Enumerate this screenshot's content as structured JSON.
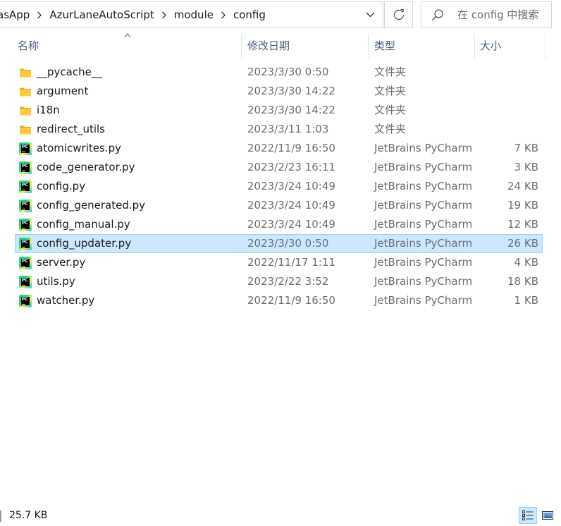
{
  "address_bar": {
    "breadcrumbs": [
      "asApp",
      "AzurLaneAutoScript",
      "module",
      "config"
    ]
  },
  "search": {
    "placeholder": "在 config 中搜索"
  },
  "columns": {
    "name": "名称",
    "date": "修改日期",
    "type": "类型",
    "size": "大小"
  },
  "files": [
    {
      "name": "__pycache__",
      "date": "2023/3/30 0:50",
      "type": "文件夹",
      "size": "",
      "icon": "folder-icon",
      "selected": false
    },
    {
      "name": "argument",
      "date": "2023/3/30 14:22",
      "type": "文件夹",
      "size": "",
      "icon": "folder-icon",
      "selected": false
    },
    {
      "name": "i18n",
      "date": "2023/3/30 14:22",
      "type": "文件夹",
      "size": "",
      "icon": "folder-icon",
      "selected": false
    },
    {
      "name": "redirect_utils",
      "date": "2023/3/11 1:03",
      "type": "文件夹",
      "size": "",
      "icon": "folder-icon",
      "selected": false
    },
    {
      "name": "atomicwrites.py",
      "date": "2022/11/9 16:50",
      "type": "JetBrains PyCharm",
      "size": "7 KB",
      "icon": "pycharm-file-icon",
      "selected": false
    },
    {
      "name": "code_generator.py",
      "date": "2023/2/23 16:11",
      "type": "JetBrains PyCharm",
      "size": "3 KB",
      "icon": "pycharm-file-icon",
      "selected": false
    },
    {
      "name": "config.py",
      "date": "2023/3/24 10:49",
      "type": "JetBrains PyCharm",
      "size": "24 KB",
      "icon": "pycharm-file-icon",
      "selected": false
    },
    {
      "name": "config_generated.py",
      "date": "2023/3/24 10:49",
      "type": "JetBrains PyCharm",
      "size": "19 KB",
      "icon": "pycharm-file-icon",
      "selected": false
    },
    {
      "name": "config_manual.py",
      "date": "2023/3/24 10:49",
      "type": "JetBrains PyCharm",
      "size": "12 KB",
      "icon": "pycharm-file-icon",
      "selected": false
    },
    {
      "name": "config_updater.py",
      "date": "2023/3/30 0:50",
      "type": "JetBrains PyCharm",
      "size": "26 KB",
      "icon": "pycharm-file-icon",
      "selected": true
    },
    {
      "name": "server.py",
      "date": "2022/11/17 1:11",
      "type": "JetBrains PyCharm",
      "size": "4 KB",
      "icon": "pycharm-file-icon",
      "selected": false
    },
    {
      "name": "utils.py",
      "date": "2023/2/22 3:52",
      "type": "JetBrains PyCharm",
      "size": "18 KB",
      "icon": "pycharm-file-icon",
      "selected": false
    },
    {
      "name": "watcher.py",
      "date": "2022/11/9 16:50",
      "type": "JetBrains PyCharm",
      "size": "1 KB",
      "icon": "pycharm-file-icon",
      "selected": false
    }
  ],
  "pycharm_icon_text": "PC",
  "status_bar": {
    "selected_size": "25.7 KB"
  },
  "colors": {
    "selection_bg": "#cce8ff",
    "selection_border": "#99d1ff",
    "header_text": "#4c607a",
    "folder": "#ffc83d"
  }
}
